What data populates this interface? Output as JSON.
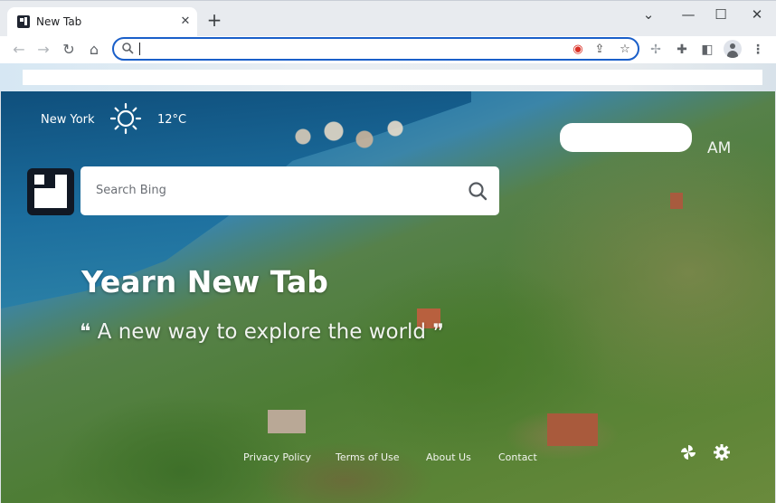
{
  "browser": {
    "tab_title": "New Tab",
    "tab_close_icon": "close-icon",
    "new_tab_icon": "plus-icon",
    "window_controls": [
      "minimize-icon",
      "restore-icon",
      "close-icon"
    ],
    "chevron_icon": "chevron-down-icon",
    "omnibox_value": "",
    "nav_icons": [
      "back-icon",
      "forward-icon",
      "reload-icon",
      "home-icon"
    ],
    "toolbar_icons": [
      "extensions-icon",
      "side-panel-icon",
      "profile-avatar",
      "more-menu-icon"
    ],
    "accent": "#1a5fc9"
  },
  "page": {
    "weather": {
      "city": "New York",
      "temperature": "12°C",
      "icon": "sun-icon"
    },
    "clock": {
      "time": "",
      "ampm": "AM"
    },
    "search": {
      "placeholder": "Search Bing"
    },
    "hero": {
      "title": "Yearn New Tab",
      "subtitle": "❝ A new way to explore the world ❞"
    },
    "footer": {
      "links": [
        "Privacy Policy",
        "Terms of Use",
        "About Us",
        "Contact"
      ],
      "icons": [
        "pinwheel-icon",
        "settings-gear-icon"
      ]
    }
  }
}
